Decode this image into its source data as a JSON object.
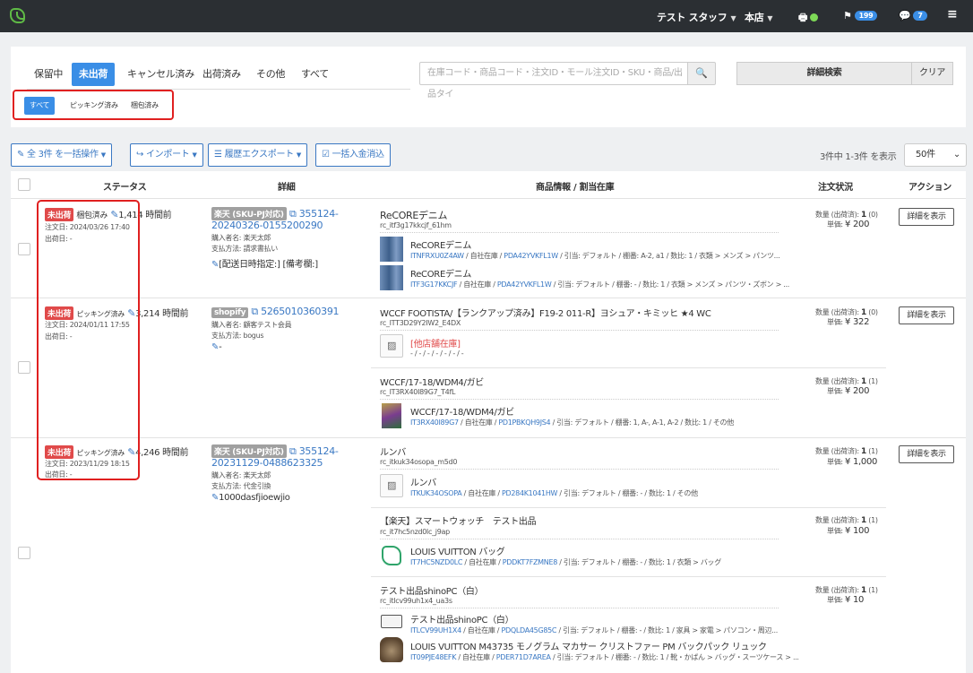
{
  "nav": {
    "staff": "テスト スタッフ",
    "store": "本店",
    "flag_count": "199",
    "chat_count": "7"
  },
  "tabs": [
    "保留中",
    "未出荷",
    "キャンセル済み",
    "出荷済み",
    "その他",
    "すべて"
  ],
  "subtabs": [
    "すべて",
    "ピッキング済み",
    "梱包済み"
  ],
  "search": {
    "placeholder": "在庫コード・商品コード・注文ID・モール注文ID・SKU・商品/出品タイ"
  },
  "buttons": {
    "detail_search": "詳細検索",
    "clear": "クリア",
    "bulk": "全 3件 を一括操作",
    "import": "インポート",
    "export": "履歴エクスポート",
    "deposit": "一括入金消込",
    "view_detail": "詳細を表示"
  },
  "pagination": {
    "count": "3件中 1-3件 を表示",
    "per_page": "50件"
  },
  "columns": {
    "status": "ステータス",
    "detail": "詳細",
    "product": "商品情報 / 割当在庫",
    "order": "注文状況",
    "action": "アクション"
  },
  "orders": [
    {
      "status": "未出荷",
      "sub": "梱包済み",
      "elapsed": "1,414 時間前",
      "order_date": "注文日: 2024/03/26 17:40",
      "ship_date": "出荷日: -",
      "mall": "楽天 (SKU-PJ対応)",
      "order_id_1": "355124-",
      "order_id_2": "20240326-0155200290",
      "buyer": "購入者名: 楽天太郎",
      "payment": "支払方法: 請求書払い",
      "memo": "[配送日時指定:] [備考欄:]",
      "item_title": "ReCOREデニム",
      "item_code": "rc_itf3g17kkcjf_61hm",
      "stocks": [
        {
          "name": "ReCOREデニム",
          "code": "ITNFRXU0Z4AW",
          "info": " / 自社在庫 / ",
          "pd": "PDA42YVKFL1W",
          "rest": " / 引当: デフォルト / 棚番: A-2, a1 / 数比: 1 / 衣類 > メンズ > パンツ..."
        },
        {
          "name": "ReCOREデニム",
          "code": "ITF3G17KKCJF",
          "info": " / 自社在庫 / ",
          "pd": "PDA42YVKFL1W",
          "rest": " / 引当: デフォルト / 棚番: - / 数比: 1 / 衣類 > メンズ > パンツ・ズボン > ..."
        }
      ],
      "qty": "数量 (出荷済): ",
      "qty_v": "1",
      "qty_p": " (0)",
      "price": "単価: ",
      "price_v": "¥ 200"
    },
    {
      "status": "未出荷",
      "sub": "ピッキング済み",
      "elapsed": "3,214 時間前",
      "order_date": "注文日: 2024/01/11 17:55",
      "ship_date": "出荷日: -",
      "mall": "shopify",
      "order_id_1": "5265010360391",
      "buyer": "購入者名: 顧客テスト会員",
      "payment": "支払方法: bogus",
      "memo": "-",
      "items": [
        {
          "title": "WCCF FOOTISTA/【ランクアップ済み】F19-2 011-R】ヨシュア・キミッヒ ★4 WC",
          "code": "rc_ITT3D29Y2IW2_E4DX",
          "stock_label": "[他店舗在庫]",
          "stock_dash": "- / - / - / - / - / - / -",
          "qty": "数量 (出荷済): ",
          "qty_v": "1",
          "qty_p": " (0)",
          "price": "単価: ",
          "price_v": "¥ 322"
        },
        {
          "title": "WCCF/17-18/WDM4/ガビ",
          "code": "rc_IT3RX40I89G7_T4fL",
          "stock_name": "WCCF/17-18/WDM4/ガビ",
          "stock_code": "IT3RX40I89G7",
          "stock_info": " / 自社在庫 / ",
          "stock_pd": "PD1PBKQH9JS4",
          "stock_rest": " / 引当: デフォルト / 棚番: 1, A-, A-1, A-2 / 数比: 1 / その他",
          "qty": "数量 (出荷済): ",
          "qty_v": "1",
          "qty_p": " (1)",
          "price": "単価: ",
          "price_v": "¥ 200"
        }
      ]
    },
    {
      "status": "未出荷",
      "sub": "ピッキング済み",
      "elapsed": "4,246 時間前",
      "order_date": "注文日: 2023/11/29 18:15",
      "ship_date": "出荷日: -",
      "mall": "楽天 (SKU-PJ対応)",
      "order_id_1": "355124-",
      "order_id_2": "20231129-0488623325",
      "buyer": "購入者名: 楽天太郎",
      "payment": "支払方法: 代金引換",
      "memo": "1000dasfjioewjio",
      "items": [
        {
          "title": "ルンバ",
          "code": "rc_itkuk34osopa_m5d0",
          "stock_name": "ルンバ",
          "stock_code": "ITKUK34OSOPA",
          "stock_info": " / 自社在庫 / ",
          "stock_pd": "PD284K1041HW",
          "stock_rest": " / 引当: デフォルト / 棚番: - / 数比: 1 / その他",
          "qty": "数量 (出荷済): ",
          "qty_v": "1",
          "qty_p": " (1)",
          "price": "単価: ",
          "price_v": "¥ 1,000"
        },
        {
          "title": "【楽天】スマートウォッチ　テスト出品",
          "code": "rc_it7hc5nzd0lc_j9ap",
          "stock_name": "LOUIS VUITTON バッグ",
          "stock_code": "IT7HC5NZD0LC",
          "stock_info": " / 自社在庫 / ",
          "stock_pd": "PDDKT7FZMNE8",
          "stock_rest": " / 引当: デフォルト / 棚番: - / 数比: 1 / 衣類 > バッグ",
          "qty": "数量 (出荷済): ",
          "qty_v": "1",
          "qty_p": " (1)",
          "price": "単価: ",
          "price_v": "¥ 100"
        },
        {
          "title": "テスト出品shinoPC（白）",
          "code": "rc_itlcv99uh1x4_ua3s",
          "stock_name": "テスト出品shinoPC（白）",
          "stock_code": "ITLCV99UH1X4",
          "stock_info": " / 自社在庫 / ",
          "stock_pd": "PDQLDA45G85C",
          "stock_rest": " / 引当: デフォルト / 棚番: - / 数比: 1 / 家具 > 家電 > パソコン・周辺...",
          "stock2_name": "LOUIS VUITTON M43735 モノグラム マカサー クリストファー PM バックパック リュック",
          "stock2_code": "IT09PJE48EFK",
          "stock2_info": " / 自社在庫 / ",
          "stock2_pd": "PDER71D7AREA",
          "stock2_rest": " / 引当: デフォルト / 棚番: - / 数比: 1 / 靴・かばん > バッグ・スーツケース > ...",
          "qty": "数量 (出荷済): ",
          "qty_v": "1",
          "qty_p": " (1)",
          "price": "単価: ",
          "price_v": "¥ 10"
        }
      ]
    }
  ]
}
